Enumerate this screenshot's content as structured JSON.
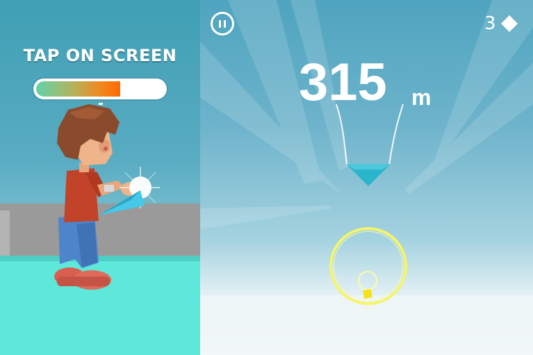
{
  "hud": {
    "instruction": "TAP ON SCREEN",
    "power_level": 0.66,
    "distance_value": "315",
    "distance_unit": "m",
    "gem_count": "3",
    "pause_icon": "pause-icon",
    "gem_icon": "diamond-icon"
  },
  "colors": {
    "floor": "#5de8da",
    "wall": "#9a9a9a",
    "target_ring": "#f5f56a",
    "pointer": "#2bb5cc",
    "hair": "#8a4b2d",
    "shirt": "#c2432a",
    "pants": "#4e84c9",
    "shoes": "#e06a5a",
    "paper_plane": "#46c8e6"
  }
}
